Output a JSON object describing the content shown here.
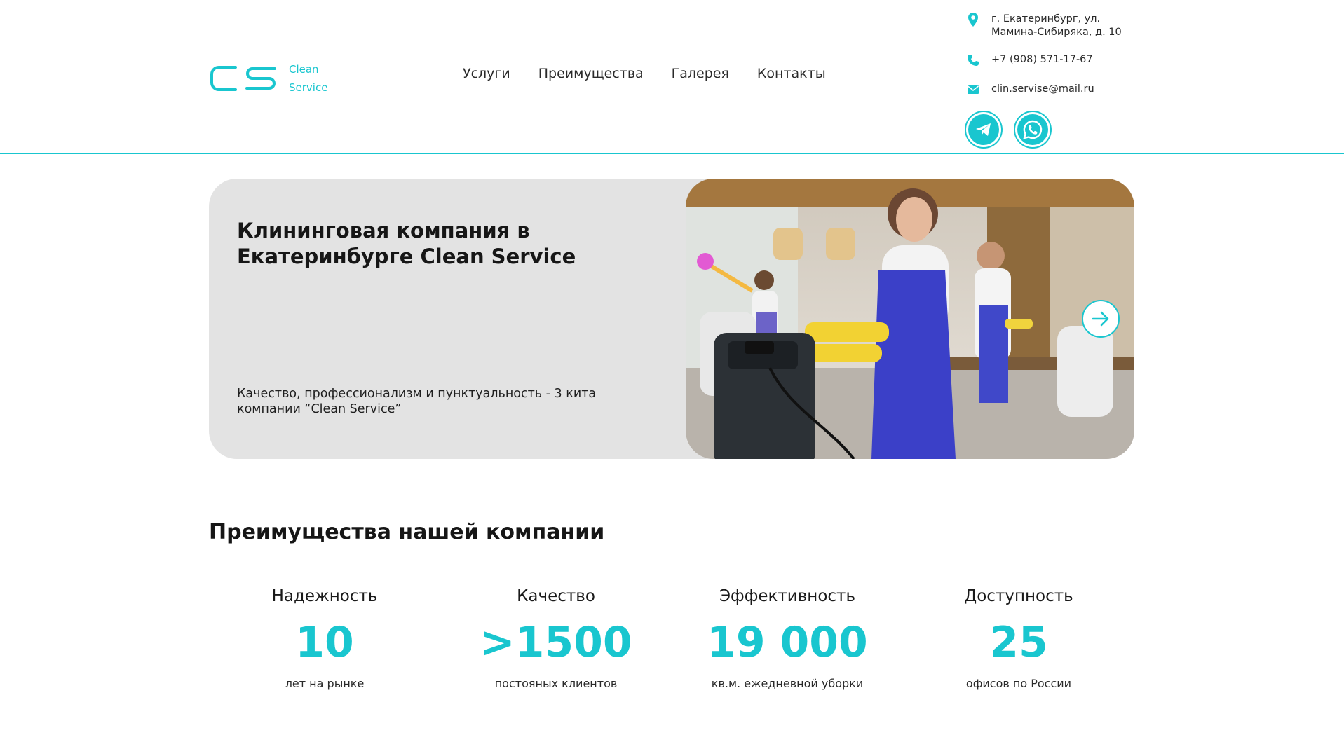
{
  "colors": {
    "accent": "#19c6cf",
    "hero_bg": "#e3e3e3"
  },
  "header": {
    "logo": {
      "mark": "CS",
      "line1": "Clean",
      "line2": "Service"
    },
    "nav": [
      "Услуги",
      "Преимущества",
      "Галерея",
      "Контакты"
    ],
    "contacts": {
      "address": "г. Екатеринбург, ул. Мамина-Сибиряка, д. 10",
      "phone": "+7 (908) 571-17-67",
      "email": "clin.servise@mail.ru"
    },
    "socials": {
      "telegram": "telegram-icon",
      "whatsapp": "whatsapp-icon"
    }
  },
  "hero": {
    "title": "Клининговая компания в Екатеринбурге Clean Service",
    "subtitle": "Качество, профессионализм и пунктуальность - 3 кита компании “Clean Service”",
    "next_icon": "arrow-right-icon"
  },
  "advantages": {
    "title": "Преимущества нашей компании",
    "items": [
      {
        "name": "Надежность",
        "value": "10",
        "caption": "лет на рынке"
      },
      {
        "name": "Качество",
        "value": ">1500",
        "caption": "постояных клиентов"
      },
      {
        "name": "Эффективность",
        "value": "19 000",
        "caption": "кв.м. ежедневной уборки"
      },
      {
        "name": "Доступность",
        "value": "25",
        "caption": "офисов по России"
      }
    ]
  }
}
